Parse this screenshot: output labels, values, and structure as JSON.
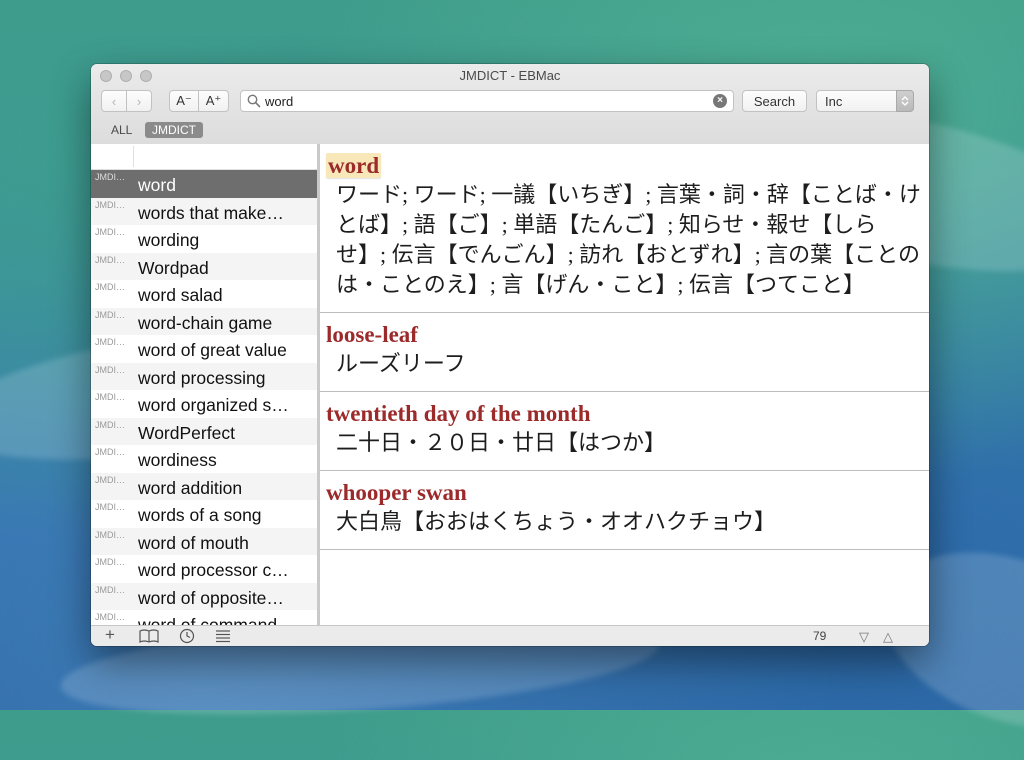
{
  "window": {
    "title": "JMDICT - EBMac"
  },
  "toolbar": {
    "back_glyph": "‹",
    "forward_glyph": "›",
    "font_decrease": "A⁻",
    "font_increase": "A⁺",
    "search_value": "word",
    "clear_glyph": "×",
    "search_button": "Search",
    "mode_value": "Inc"
  },
  "tabs": [
    {
      "label": "ALL",
      "active": false
    },
    {
      "label": "JMDICT",
      "active": true
    }
  ],
  "results": [
    {
      "source": "JMDI…",
      "word": "word"
    },
    {
      "source": "JMDI…",
      "word": "words that make…"
    },
    {
      "source": "JMDI…",
      "word": "wording"
    },
    {
      "source": "JMDI…",
      "word": "Wordpad"
    },
    {
      "source": "JMDI…",
      "word": "word salad"
    },
    {
      "source": "JMDI…",
      "word": "word-chain game"
    },
    {
      "source": "JMDI…",
      "word": "word of great value"
    },
    {
      "source": "JMDI…",
      "word": "word processing"
    },
    {
      "source": "JMDI…",
      "word": "word organized s…"
    },
    {
      "source": "JMDI…",
      "word": "WordPerfect"
    },
    {
      "source": "JMDI…",
      "word": "wordiness"
    },
    {
      "source": "JMDI…",
      "word": "word addition"
    },
    {
      "source": "JMDI…",
      "word": "words of a song"
    },
    {
      "source": "JMDI…",
      "word": "word of mouth"
    },
    {
      "source": "JMDI…",
      "word": "word processor c…"
    },
    {
      "source": "JMDI…",
      "word": "word of opposite…"
    },
    {
      "source": "JMDI…",
      "word": "word of command"
    }
  ],
  "entries": [
    {
      "headword": "word",
      "definition": "ワード; ワード; 一議【いちぎ】; 言葉・詞・辞【ことば・けとば】; 語【ご】; 単語【たんご】; 知らせ・報せ【しらせ】; 伝言【でんごん】; 訪れ【おとずれ】; 言の葉【ことのは・ことのえ】; 言【げん・こと】; 伝言【つてこと】"
    },
    {
      "headword": "loose-leaf",
      "definition": "ルーズリーフ"
    },
    {
      "headword": "twentieth day of the month",
      "definition": "二十日・２０日・廿日【はつか】"
    },
    {
      "headword": "whooper swan",
      "definition": "大白鳥【おおはくちょう・オオハクチョウ】"
    }
  ],
  "status": {
    "count": "79",
    "add_glyph": "+",
    "prev_glyph": "▽",
    "next_glyph": "△"
  }
}
